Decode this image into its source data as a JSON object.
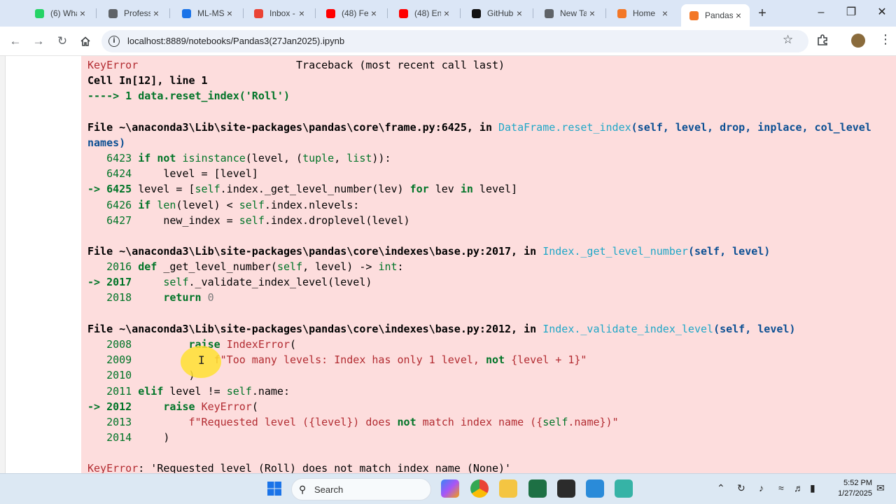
{
  "browser": {
    "tabs": [
      {
        "title": "(6) Wha",
        "icon": "whatsapp-icon",
        "color": "#25d366"
      },
      {
        "title": "Profess",
        "icon": "globe-icon",
        "color": "#5f6368"
      },
      {
        "title": "ML-MS",
        "icon": "drive-icon",
        "color": "#1a73e8"
      },
      {
        "title": "Inbox -",
        "icon": "gmail-icon",
        "color": "#ea4335"
      },
      {
        "title": "(48) Fe",
        "icon": "youtube-icon",
        "color": "#ff0000"
      },
      {
        "title": "(48) En",
        "icon": "youtube-icon",
        "color": "#ff0000"
      },
      {
        "title": "GitHub",
        "icon": "github-icon",
        "color": "#111111"
      },
      {
        "title": "New Ta",
        "icon": "chrome-icon",
        "color": "#5f6368"
      },
      {
        "title": "Home",
        "icon": "jupyter-icon",
        "color": "#f37726"
      },
      {
        "title": "Pandas",
        "icon": "jupyter-icon",
        "color": "#f37726",
        "active": true
      }
    ],
    "url": "localhost:8889/notebooks/Pandas3(27Jan2025).ipynb",
    "new_tab_symbol": "+",
    "close_symbol": "×"
  },
  "traceback": {
    "header_error": "KeyError",
    "header_title": "Traceback (most recent call last)",
    "cell_ref": "Cell In[12], line 1",
    "arrow_line": "----> 1 data.reset_index('Roll')",
    "frame1_file": "File ~\\anaconda3\\Lib\\site-packages\\pandas\\core\\frame.py:6425, in ",
    "frame1_func": "DataFrame.reset_index",
    "frame1_sig": "(self, level, drop, inplace, col_level",
    "frame1_cont": "names)",
    "frame1_lines": [
      {
        "no": "6423",
        "arrow": "   ",
        "code": "if not isinstance(level, (tuple, list)):"
      },
      {
        "no": "6424",
        "arrow": "   ",
        "code": "    level = [level]"
      },
      {
        "no": "6425",
        "arrow": "-> ",
        "code": "level = [self.index._get_level_number(lev) for lev in level]"
      },
      {
        "no": "6426",
        "arrow": "   ",
        "code": "if len(level) < self.index.nlevels:"
      },
      {
        "no": "6427",
        "arrow": "   ",
        "code": "    new_index = self.index.droplevel(level)"
      }
    ],
    "frame2_file": "File ~\\anaconda3\\Lib\\site-packages\\pandas\\core\\indexes\\base.py:2017, in ",
    "frame2_func": "Index._get_level_number",
    "frame2_sig": "(self, level)",
    "frame2_lines": [
      {
        "no": "2016",
        "arrow": "   ",
        "code": "def _get_level_number(self, level) -> int:"
      },
      {
        "no": "2017",
        "arrow": "-> ",
        "code": "    self._validate_index_level(level)"
      },
      {
        "no": "2018",
        "arrow": "   ",
        "code": "    return 0"
      }
    ],
    "frame3_file": "File ~\\anaconda3\\Lib\\site-packages\\pandas\\core\\indexes\\base.py:2012, in ",
    "frame3_func": "Index._validate_index_level",
    "frame3_sig": "(self, level)",
    "frame3_lines": [
      {
        "no": "2008",
        "arrow": "   ",
        "code": "        raise IndexError("
      },
      {
        "no": "2009",
        "arrow": "   ",
        "code": "            f\"Too many levels: Index has only 1 level, not {level + 1}\""
      },
      {
        "no": "2010",
        "arrow": "   ",
        "code": "        )"
      },
      {
        "no": "2011",
        "arrow": "   ",
        "code": "elif level != self.name:"
      },
      {
        "no": "2012",
        "arrow": "-> ",
        "code": "    raise KeyError("
      },
      {
        "no": "2013",
        "arrow": "   ",
        "code": "        f\"Requested level ({level}) does not match index name ({self.name})\""
      },
      {
        "no": "2014",
        "arrow": "   ",
        "code": "    )"
      }
    ],
    "final_error": "KeyError",
    "final_message": ": 'Requested level (Roll) does not match index name (None)'"
  },
  "taskbar": {
    "search_label": "Search",
    "time": "5:52 PM",
    "date": "1/27/2025"
  }
}
